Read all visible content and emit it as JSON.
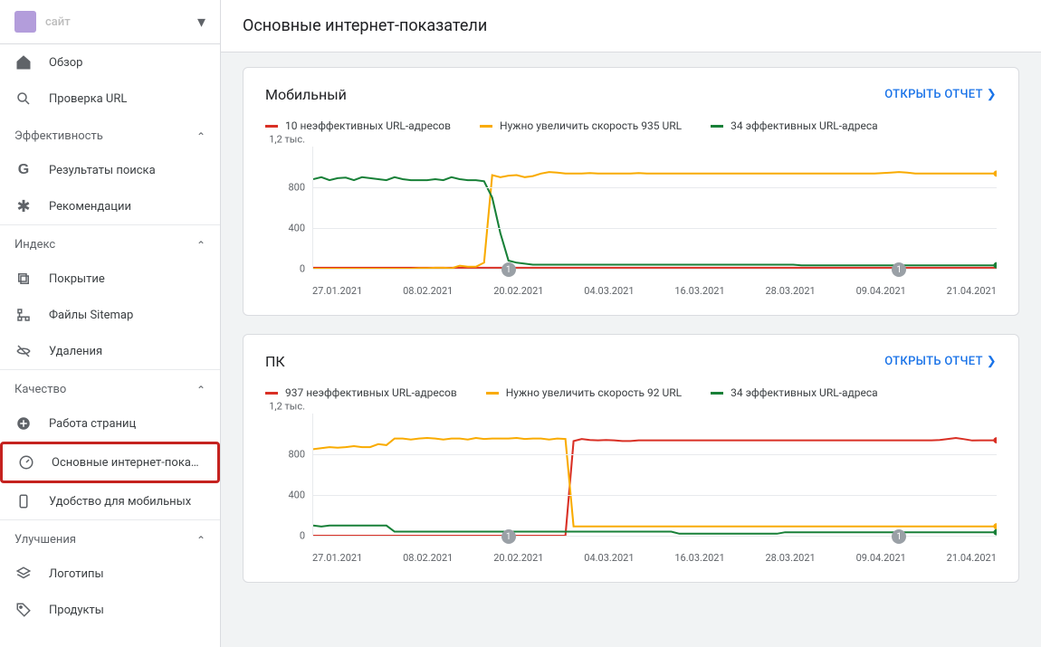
{
  "property": {
    "name": "сайт"
  },
  "page_title": "Основные интернет-показатели",
  "sidebar": {
    "top_items": [
      {
        "label": "Обзор",
        "icon": "home"
      },
      {
        "label": "Проверка URL",
        "icon": "search"
      }
    ],
    "sections": [
      {
        "title": "Эффективность",
        "items": [
          {
            "label": "Результаты поиска",
            "icon": "g"
          },
          {
            "label": "Рекомендации",
            "icon": "asterisk"
          }
        ]
      },
      {
        "title": "Индекс",
        "items": [
          {
            "label": "Покрытие",
            "icon": "copy"
          },
          {
            "label": "Файлы Sitemap",
            "icon": "sitemap"
          },
          {
            "label": "Удаления",
            "icon": "no-eye"
          }
        ]
      },
      {
        "title": "Качество",
        "items": [
          {
            "label": "Работа страниц",
            "icon": "plus-circle"
          },
          {
            "label": "Основные интернет-показ…",
            "icon": "speed",
            "highlight": true
          },
          {
            "label": "Удобство для мобильных",
            "icon": "mobile"
          }
        ]
      },
      {
        "title": "Улучшения",
        "items": [
          {
            "label": "Логотипы",
            "icon": "layers"
          },
          {
            "label": "Продукты",
            "icon": "tag"
          }
        ]
      }
    ]
  },
  "open_report_label": "ОТКРЫТЬ ОТЧЕТ",
  "colors": {
    "poor": "#d93025",
    "improve": "#f9ab00",
    "good": "#188038"
  },
  "cards": [
    {
      "title": "Мобильный",
      "legend": [
        {
          "label": "10 неэффективных URL-адресов",
          "color_key": "poor"
        },
        {
          "label": "Нужно увеличить скорость 935 URL",
          "color_key": "improve"
        },
        {
          "label": "34 эффективных URL-адреса",
          "color_key": "good"
        }
      ],
      "y_top_label": "1,2 тыс.",
      "chart_data": {
        "type": "line",
        "ylim": [
          0,
          1200
        ],
        "y_ticks": [
          0,
          400,
          800
        ],
        "x_dates": [
          "27.01.2021",
          "08.02.2021",
          "20.02.2021",
          "04.03.2021",
          "16.03.2021",
          "28.03.2021",
          "09.04.2021",
          "21.04.2021"
        ],
        "markers": [
          {
            "at_index": 2,
            "label": "1"
          },
          {
            "at_index": 6,
            "label": "1"
          }
        ],
        "series": [
          {
            "name": "poor",
            "color_key": "poor",
            "values": [
              10,
              10,
              10,
              10,
              10,
              10,
              10,
              10,
              10,
              10,
              10,
              10,
              10,
              10,
              10,
              10,
              10,
              10,
              10,
              10,
              10,
              10,
              10,
              10,
              10,
              10,
              10,
              10,
              10,
              10,
              10,
              10,
              10,
              10,
              10,
              10,
              10,
              10,
              10,
              10,
              10,
              10,
              10,
              10,
              10,
              10,
              10,
              10,
              10,
              10,
              10,
              10,
              10,
              10,
              10,
              10,
              10,
              10,
              10,
              10,
              10,
              10,
              10,
              10,
              10,
              10,
              10,
              10,
              10,
              10,
              10,
              10,
              10,
              10,
              10,
              10,
              10,
              10,
              10,
              10,
              10,
              10,
              10,
              10,
              10
            ]
          },
          {
            "name": "improve",
            "color_key": "improve",
            "values": [
              0,
              0,
              0,
              0,
              0,
              0,
              0,
              0,
              0,
              0,
              0,
              0,
              0,
              5,
              5,
              10,
              10,
              5,
              30,
              20,
              20,
              60,
              920,
              900,
              915,
              920,
              900,
              910,
              935,
              950,
              945,
              935,
              935,
              935,
              940,
              935,
              935,
              935,
              935,
              935,
              940,
              935,
              935,
              935,
              935,
              935,
              935,
              935,
              935,
              935,
              935,
              935,
              935,
              935,
              935,
              935,
              935,
              935,
              935,
              935,
              935,
              935,
              935,
              935,
              935,
              935,
              935,
              935,
              935,
              935,
              940,
              945,
              950,
              945,
              935,
              935,
              935,
              935,
              935,
              935,
              935,
              935,
              935,
              935,
              935
            ],
            "end_dot": true
          },
          {
            "name": "good",
            "color_key": "good",
            "values": [
              880,
              900,
              870,
              890,
              895,
              870,
              900,
              890,
              880,
              870,
              900,
              880,
              870,
              870,
              870,
              880,
              870,
              900,
              880,
              870,
              870,
              860,
              700,
              350,
              80,
              60,
              50,
              40,
              40,
              40,
              40,
              40,
              40,
              40,
              40,
              40,
              40,
              40,
              40,
              40,
              40,
              40,
              40,
              40,
              40,
              40,
              40,
              40,
              40,
              40,
              40,
              40,
              40,
              40,
              40,
              40,
              40,
              40,
              40,
              40,
              34,
              34,
              34,
              34,
              34,
              34,
              34,
              34,
              34,
              34,
              34,
              34,
              34,
              34,
              34,
              34,
              34,
              34,
              34,
              34,
              34,
              34,
              34,
              34,
              34
            ],
            "end_dot": true
          }
        ]
      }
    },
    {
      "title": "ПК",
      "legend": [
        {
          "label": "937 неэффективных URL-адресов",
          "color_key": "poor"
        },
        {
          "label": "Нужно увеличить скорость 92 URL",
          "color_key": "improve"
        },
        {
          "label": "34 эффективных URL-адреса",
          "color_key": "good"
        }
      ],
      "y_top_label": "1,2 тыс.",
      "chart_data": {
        "type": "line",
        "ylim": [
          0,
          1200
        ],
        "y_ticks": [
          0,
          400,
          800
        ],
        "x_dates": [
          "27.01.2021",
          "08.02.2021",
          "20.02.2021",
          "04.03.2021",
          "16.03.2021",
          "28.03.2021",
          "09.04.2021",
          "21.04.2021"
        ],
        "markers": [
          {
            "at_index": 2,
            "label": "1"
          },
          {
            "at_index": 6,
            "label": "1"
          }
        ],
        "series": [
          {
            "name": "poor",
            "color_key": "poor",
            "values": [
              0,
              0,
              0,
              0,
              0,
              0,
              0,
              0,
              0,
              0,
              0,
              0,
              0,
              0,
              0,
              0,
              0,
              0,
              0,
              0,
              0,
              0,
              0,
              0,
              0,
              0,
              0,
              0,
              0,
              0,
              0,
              0,
              930,
              950,
              940,
              937,
              940,
              937,
              930,
              930,
              937,
              937,
              937,
              937,
              937,
              937,
              937,
              937,
              937,
              937,
              937,
              937,
              937,
              937,
              937,
              937,
              937,
              937,
              937,
              937,
              937,
              937,
              937,
              937,
              937,
              937,
              937,
              937,
              937,
              937,
              937,
              937,
              937,
              937,
              937,
              937,
              937,
              940,
              950,
              960,
              948,
              935,
              937,
              937,
              937
            ],
            "end_dot": true
          },
          {
            "name": "improve",
            "color_key": "improve",
            "values": [
              850,
              860,
              870,
              865,
              870,
              880,
              870,
              870,
              900,
              890,
              955,
              955,
              945,
              955,
              960,
              955,
              945,
              955,
              955,
              945,
              960,
              950,
              955,
              955,
              955,
              960,
              950,
              955,
              955,
              945,
              955,
              950,
              92,
              92,
              92,
              92,
              92,
              92,
              92,
              92,
              92,
              92,
              92,
              92,
              92,
              92,
              92,
              92,
              92,
              92,
              92,
              92,
              92,
              92,
              92,
              92,
              92,
              92,
              92,
              92,
              92,
              92,
              92,
              92,
              92,
              92,
              92,
              92,
              92,
              92,
              92,
              92,
              92,
              92,
              92,
              92,
              92,
              92,
              92,
              92,
              92,
              92,
              92,
              92,
              92
            ],
            "end_dot": true
          },
          {
            "name": "good",
            "color_key": "good",
            "values": [
              100,
              90,
              100,
              100,
              100,
              100,
              100,
              100,
              100,
              100,
              40,
              40,
              40,
              40,
              40,
              40,
              40,
              40,
              40,
              40,
              40,
              40,
              40,
              40,
              40,
              40,
              40,
              40,
              40,
              40,
              40,
              40,
              40,
              40,
              40,
              40,
              40,
              40,
              40,
              40,
              40,
              40,
              40,
              40,
              40,
              20,
              20,
              20,
              20,
              20,
              20,
              20,
              20,
              20,
              20,
              20,
              20,
              20,
              34,
              34,
              34,
              34,
              34,
              34,
              34,
              34,
              34,
              34,
              34,
              34,
              34,
              34,
              34,
              34,
              34,
              34,
              34,
              34,
              34,
              34,
              34,
              34,
              34,
              34,
              34
            ],
            "end_dot": true
          }
        ]
      }
    }
  ]
}
